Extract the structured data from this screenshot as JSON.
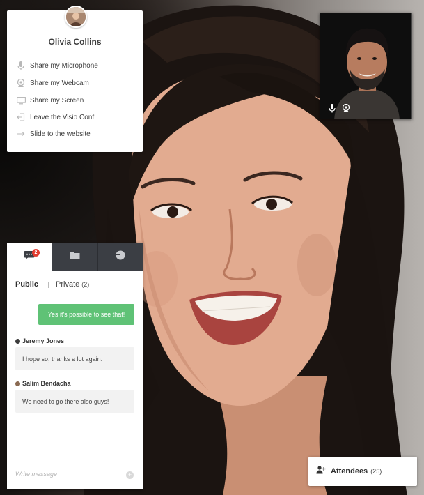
{
  "profile": {
    "name": "Olivia Collins",
    "menu": [
      {
        "icon": "microphone-icon",
        "label": "Share my Microphone"
      },
      {
        "icon": "webcam-icon",
        "label": "Share my Webcam"
      },
      {
        "icon": "screen-icon",
        "label": "Share my Screen"
      },
      {
        "icon": "leave-icon",
        "label": "Leave the Visio Conf"
      },
      {
        "icon": "arrow-right-icon",
        "label": "Slide to the website"
      }
    ]
  },
  "chat": {
    "tabs": [
      {
        "icon": "chat-icon",
        "badge": "2"
      },
      {
        "icon": "folder-icon"
      },
      {
        "icon": "pie-chart-icon"
      }
    ],
    "subtabs": {
      "public": "Public",
      "private": "Private",
      "private_count": "(2)"
    },
    "messages": [
      {
        "author": "",
        "text": "Yes it's possible to see that!"
      },
      {
        "author": "Jeremy Jones",
        "text": "I hope so, thanks a lot again."
      },
      {
        "author": "Salim Bendacha",
        "text": "We need to go there also guys!"
      }
    ],
    "input_placeholder": "Write message",
    "send_icon": "plus-icon"
  },
  "attendees": {
    "label": "Attendees",
    "count": "(25)",
    "icon": "users-icon"
  },
  "colors": {
    "accent_green": "#5fc276",
    "badge_red": "#e33b2f",
    "tab_dark": "#3b3e44"
  }
}
